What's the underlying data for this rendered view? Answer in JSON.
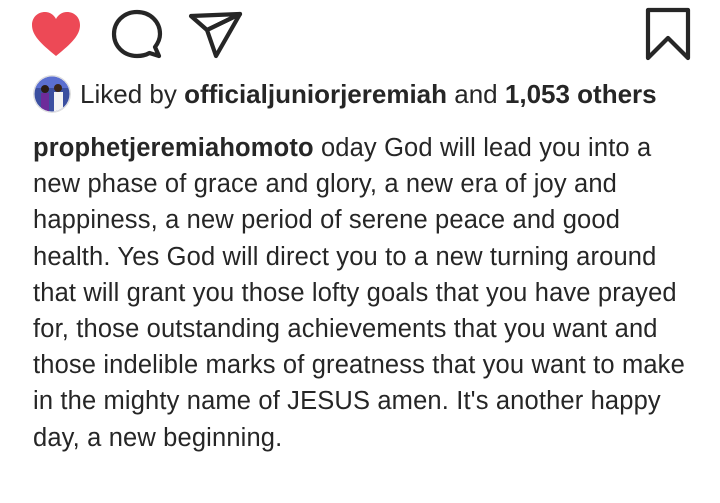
{
  "actions": {
    "like_icon": "heart-filled",
    "like_color": "#ed4956",
    "comment_icon": "comment",
    "share_icon": "paper-plane",
    "save_icon": "bookmark"
  },
  "likes": {
    "prefix": "Liked by",
    "user": "officialjuniorjeremiah",
    "joiner": "and",
    "others": "1,053 others"
  },
  "caption": {
    "username": "prophetjeremiahomoto",
    "text": "oday God will lead you into a new phase of grace and glory, a new era of joy and happiness, a new period of serene peace and good health. Yes God will direct you to a new turning around that will grant you those lofty goals that you have prayed for, those outstanding achievements that you want and those indelible marks of greatness that you want to make in the mighty name of JESUS amen. It's another happy day, a new beginning."
  }
}
